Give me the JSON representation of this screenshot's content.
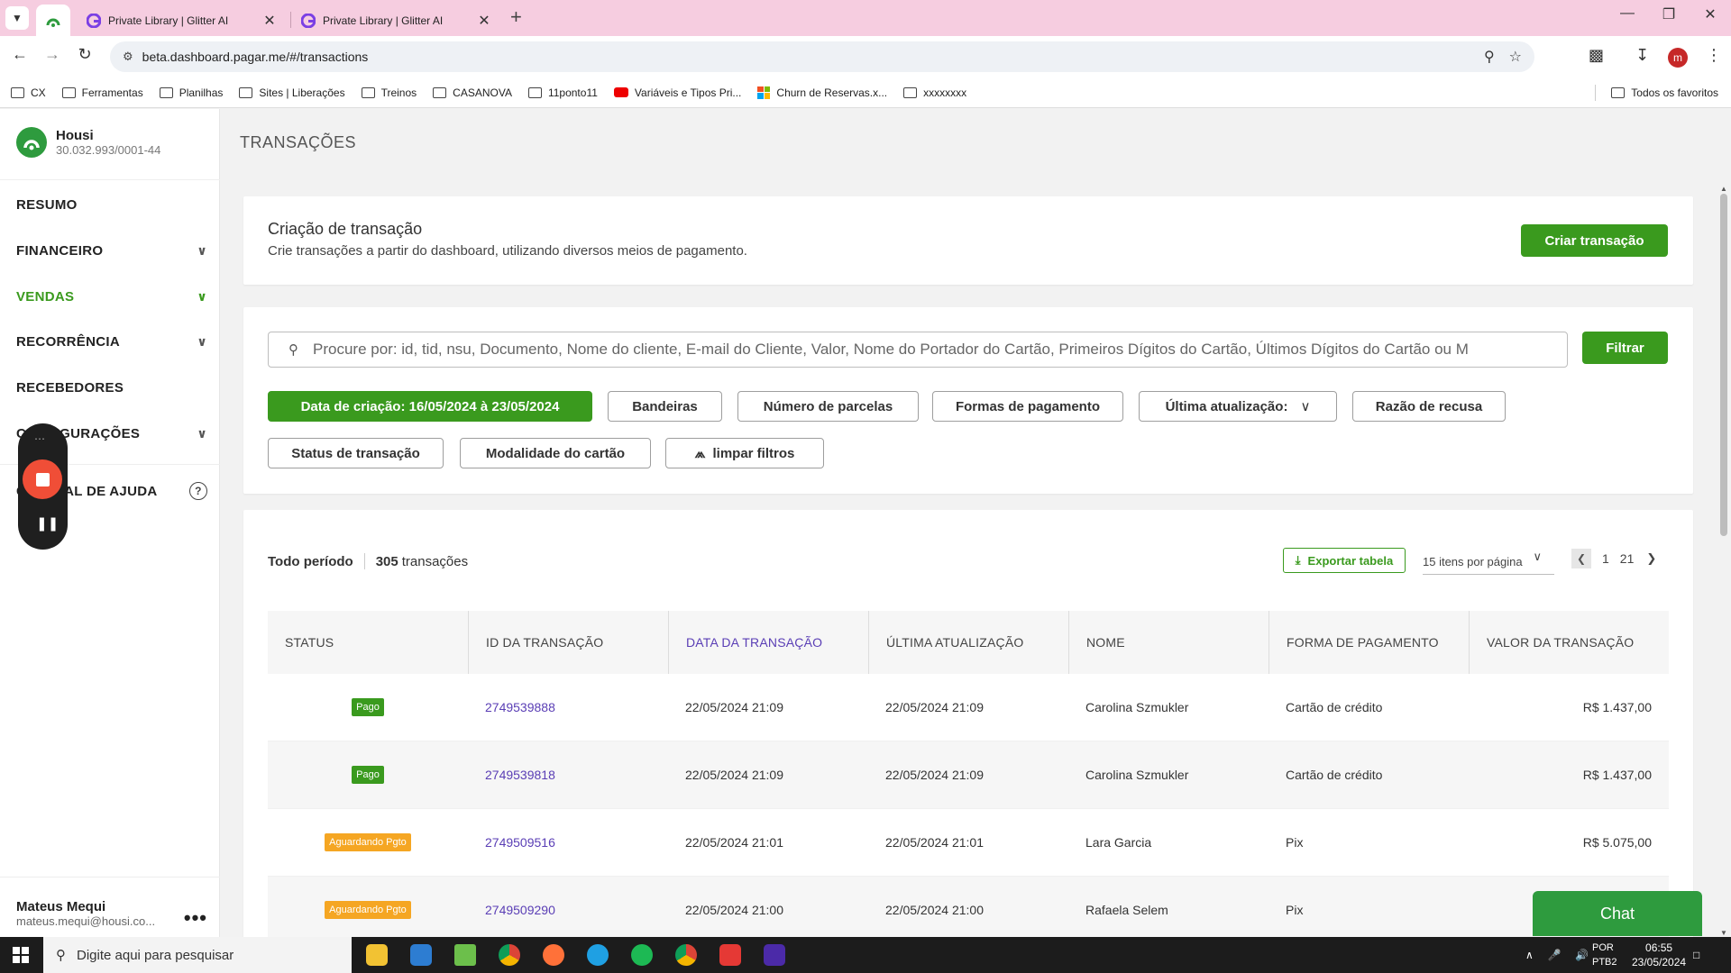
{
  "browser": {
    "tabs": [
      {
        "title": "Private Library | Glitter AI"
      },
      {
        "title": "Private Library | Glitter AI"
      }
    ],
    "url": "beta.dashboard.pagar.me/#/transactions",
    "profile_initial": "m",
    "bookmarks": [
      {
        "label": "CX",
        "icon": "folder-icon"
      },
      {
        "label": "Ferramentas",
        "icon": "folder-icon"
      },
      {
        "label": "Planilhas",
        "icon": "folder-icon"
      },
      {
        "label": "Sites | Liberações",
        "icon": "folder-icon"
      },
      {
        "label": "Treinos",
        "icon": "folder-icon"
      },
      {
        "label": "CASANOVA",
        "icon": "folder-icon"
      },
      {
        "label": "11ponto11",
        "icon": "folder-icon"
      },
      {
        "label": "Variáveis e Tipos Pri...",
        "icon": "youtube-icon"
      },
      {
        "label": "Churn de Reservas.x...",
        "icon": "microsoft-icon"
      },
      {
        "label": "xxxxxxxx",
        "icon": "folder-icon"
      }
    ],
    "all_bookmarks": "Todos os favoritos"
  },
  "sidebar": {
    "company_name": "Housi",
    "company_cnpj": "30.032.993/0001-44",
    "menu": {
      "resumo": "RESUMO",
      "financeiro": "FINANCEIRO",
      "vendas": "VENDAS",
      "recorrencia": "RECORRÊNCIA",
      "recebedores": "RECEBEDORES",
      "configuracoes": "CONFIGURAÇÕES",
      "ajuda": "CENTRAL DE AJUDA"
    },
    "user_name": "Mateus Mequi",
    "user_email": "mateus.mequi@housi.co..."
  },
  "page": {
    "title": "TRANSAÇÕES"
  },
  "create": {
    "heading": "Criação de transação",
    "subtitle": "Crie transações a partir do dashboard, utilizando diversos meios de pagamento.",
    "button": "Criar transação"
  },
  "filters": {
    "search_placeholder": "Procure por: id, tid, nsu, Documento, Nome do cliente, E-mail do Cliente, Valor, Nome do Portador do Cartão, Primeiros Dígitos do Cartão, Últimos Dígitos do Cartão ou M",
    "filter_button": "Filtrar",
    "chips": {
      "date": "Data de criação: 16/05/2024 à 23/05/2024",
      "bandeiras": "Bandeiras",
      "parcelas": "Número de parcelas",
      "formas": "Formas de pagamento",
      "ultima": "Última atualização:",
      "recusa": "Razão de recusa",
      "status": "Status de transação",
      "modalidade": "Modalidade do cartão",
      "limpar": "limpar filtros"
    }
  },
  "table": {
    "period": "Todo período",
    "count": "305",
    "count_label": "transações",
    "export": "Exportar tabela",
    "per_page": "15 itens por página",
    "page_current": "1",
    "page_total": "21",
    "headers": {
      "status": "STATUS",
      "id": "ID DA TRANSAÇÃO",
      "date": "DATA DA TRANSAÇÃO",
      "updated": "ÚLTIMA ATUALIZAÇÃO",
      "name": "NOME",
      "method": "FORMA DE PAGAMENTO",
      "value": "VALOR DA TRANSAÇÃO"
    },
    "rows": [
      {
        "status": "Pago",
        "status_kind": "paid",
        "id": "2749539888",
        "date": "22/05/2024 21:09",
        "updated": "22/05/2024 21:09",
        "name": "Carolina Szmukler",
        "method": "Cartão de crédito",
        "value": "R$ 1.437,00"
      },
      {
        "status": "Pago",
        "status_kind": "paid",
        "id": "2749539818",
        "date": "22/05/2024 21:09",
        "updated": "22/05/2024 21:09",
        "name": "Carolina Szmukler",
        "method": "Cartão de crédito",
        "value": "R$ 1.437,00"
      },
      {
        "status": "Aguardando Pgto",
        "status_kind": "wait",
        "id": "2749509516",
        "date": "22/05/2024 21:01",
        "updated": "22/05/2024 21:01",
        "name": "Lara Garcia",
        "method": "Pix",
        "value": "R$ 5.075,00"
      },
      {
        "status": "Aguardando Pgto",
        "status_kind": "wait",
        "id": "2749509290",
        "date": "22/05/2024 21:00",
        "updated": "22/05/2024 21:00",
        "name": "Rafaela Selem",
        "method": "Pix",
        "value": ""
      }
    ]
  },
  "chat": {
    "label": "Chat"
  },
  "taskbar": {
    "search_placeholder": "Digite aqui para pesquisar",
    "lang_1": "POR",
    "lang_2": "PTB2",
    "time": "06:55",
    "date": "23/05/2024"
  },
  "colors": {
    "accent_green": "#3a9a1e",
    "link_purple": "#5a3eb5",
    "pending_orange": "#f5a623",
    "tabbar_pink": "#f6cde0"
  }
}
